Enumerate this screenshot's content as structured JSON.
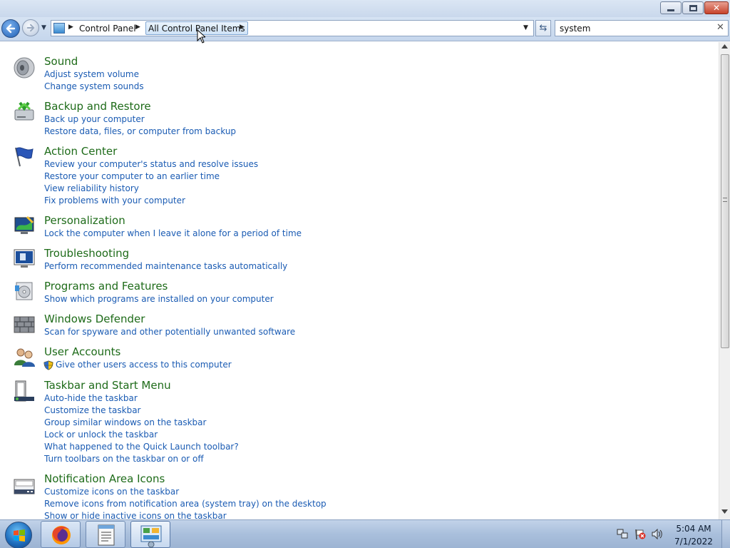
{
  "window": {
    "min_icon": "minimize-icon",
    "max_icon": "restore-icon",
    "close_icon": "close-icon",
    "close_glyph": "✕"
  },
  "nav": {
    "back_icon": "back-arrow-icon",
    "forward_icon": "forward-arrow-icon",
    "breadcrumbs": [
      "Control Panel",
      "All Control Panel Items"
    ],
    "separator_glyph": "▶",
    "dropdown_glyph": "▼",
    "refresh_glyph": "⇆"
  },
  "search": {
    "value": "system",
    "clear_glyph": "✕"
  },
  "categories": [
    {
      "title": "Sound",
      "icon": "speaker-icon",
      "links": [
        "Adjust system volume",
        "Change system sounds"
      ]
    },
    {
      "title": "Backup and Restore",
      "icon": "backup-icon",
      "links": [
        "Back up your computer",
        "Restore data, files, or computer from backup"
      ]
    },
    {
      "title": "Action Center",
      "icon": "flag-icon",
      "links": [
        "Review your computer's status and resolve issues",
        "Restore your computer to an earlier time",
        "View reliability history",
        "Fix problems with your computer"
      ]
    },
    {
      "title": "Personalization",
      "icon": "personalization-icon",
      "links": [
        "Lock the computer when I leave it alone for a period of time"
      ]
    },
    {
      "title": "Troubleshooting",
      "icon": "troubleshooting-icon",
      "links": [
        "Perform recommended maintenance tasks automatically"
      ]
    },
    {
      "title": "Programs and Features",
      "icon": "programs-icon",
      "links": [
        "Show which programs are installed on your computer"
      ]
    },
    {
      "title": "Windows Defender",
      "icon": "defender-wall-icon",
      "links": [
        "Scan for spyware and other potentially unwanted software"
      ]
    },
    {
      "title": "User Accounts",
      "icon": "users-icon",
      "links": [
        "Give other users access to this computer"
      ]
    },
    {
      "title": "Taskbar and Start Menu",
      "icon": "taskbar-icon",
      "links": [
        "Auto-hide the taskbar",
        "Customize the taskbar",
        "Group similar windows on the taskbar",
        "Lock or unlock the taskbar",
        "What happened to the Quick Launch toolbar?",
        "Turn toolbars on the taskbar on or off"
      ]
    },
    {
      "title": "Notification Area Icons",
      "icon": "notification-area-icon",
      "links": [
        "Customize icons on the taskbar",
        "Remove icons from notification area (system tray) on the desktop",
        "Show or hide inactive icons on the taskbar"
      ]
    }
  ],
  "taskbar": {
    "start_icon": "windows-start-icon",
    "apps": [
      {
        "icon": "firefox-icon"
      },
      {
        "icon": "notepad-icon"
      },
      {
        "icon": "control-panel-icon"
      }
    ],
    "tray": [
      "network-icon",
      "action-center-warning-icon",
      "volume-icon"
    ],
    "time": "5:04 AM",
    "date": "7/1/2022"
  },
  "colors": {
    "category_title": "#1e6b19",
    "link": "#1a5bb3"
  }
}
